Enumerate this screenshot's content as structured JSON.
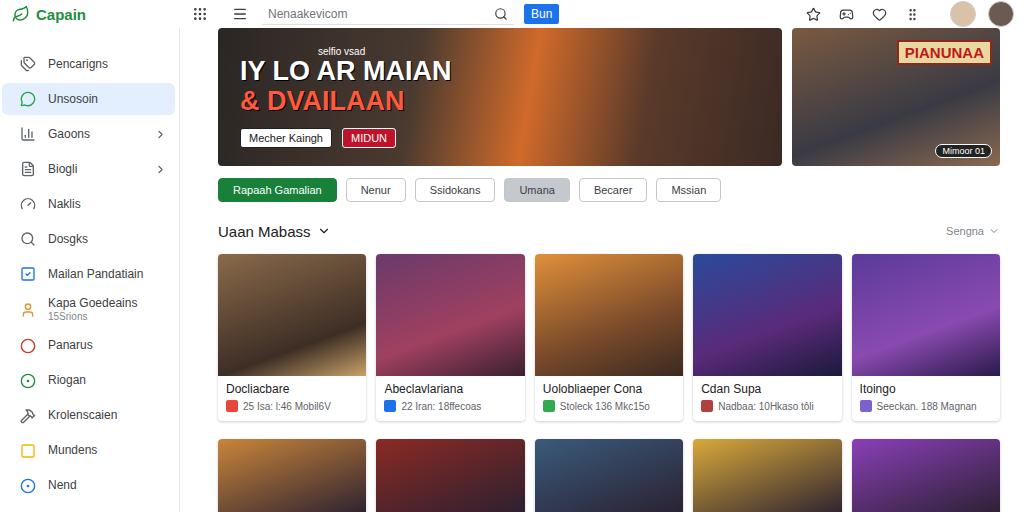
{
  "header": {
    "logo": "Capain",
    "search": {
      "placeholder": "Nenaakevicom"
    },
    "button": "Bun"
  },
  "sidebar": {
    "items": [
      {
        "label": "Pencarigns",
        "selected": false,
        "chevron": false,
        "color": "#5f6368"
      },
      {
        "label": "Unsosoin",
        "selected": true,
        "chevron": false,
        "color": "#25a244"
      },
      {
        "label": "Gaoons",
        "selected": false,
        "chevron": true,
        "color": "#5f6368"
      },
      {
        "label": "Biogli",
        "selected": false,
        "chevron": true,
        "color": "#5f6368"
      },
      {
        "label": "Naklis",
        "selected": false,
        "chevron": false,
        "color": "#5f6368"
      },
      {
        "label": "Dosgks",
        "selected": false,
        "chevron": false,
        "color": "#5f6368"
      },
      {
        "label": "Mailan Pandatiain",
        "selected": false,
        "chevron": false,
        "color": "#1a73e8"
      },
      {
        "label": "Kapa Goedeains",
        "sub": "15Srions",
        "selected": false,
        "chevron": false,
        "color": "#e8912d"
      },
      {
        "label": "Panarus",
        "selected": false,
        "chevron": false,
        "color": "#d93025"
      },
      {
        "label": "Riogan",
        "selected": false,
        "chevron": false,
        "color": "#1e8e3e"
      },
      {
        "label": "Krolenscaien",
        "selected": false,
        "chevron": false,
        "color": "#5f6368"
      },
      {
        "label": "Mundens",
        "selected": false,
        "chevron": false,
        "color": "#f4b400"
      },
      {
        "label": "Nend",
        "selected": false,
        "chevron": false,
        "color": "#1a73e8"
      }
    ]
  },
  "hero": {
    "kicker": "selfio vsad",
    "title": [
      "IY LO AR MAIAN",
      "& DVAILAAN"
    ],
    "buttons": [
      "Mecher Kaingh",
      "MIDUN"
    ]
  },
  "promo": {
    "title": "PIANUNAA",
    "badge": "Mimoor 01"
  },
  "filters": [
    {
      "label": "Rapaah Gamalian",
      "selected": true,
      "pressed": false
    },
    {
      "label": "Nenur",
      "selected": false,
      "pressed": false
    },
    {
      "label": "Ssidokans",
      "selected": false,
      "pressed": false
    },
    {
      "label": "Umana",
      "selected": false,
      "pressed": true
    },
    {
      "label": "Becarer",
      "selected": false,
      "pressed": false
    },
    {
      "label": "Mssian",
      "selected": false,
      "pressed": false
    }
  ],
  "section": {
    "title": "Uaan Mabass",
    "sort": "Sengna"
  },
  "cards": [
    {
      "title": "Docliacbare",
      "meta": "25 Isa: l:46 Mobil6V",
      "color": "#e8453c"
    },
    {
      "title": "Abeclavlariana",
      "meta": "22 Iran: 18ffecoas",
      "color": "#1a73e8"
    },
    {
      "title": "Uolobliaeper Cona",
      "meta": "Stoleck 136 Mkc15o",
      "color": "#34a853"
    },
    {
      "title": "Cdan Supa",
      "meta": "Nadbaa: 10Hkaso tôli",
      "color": "#b0413e"
    },
    {
      "title": "Itoingo",
      "meta": "Seeckan. 188 Magnan",
      "color": "#7b61c9"
    }
  ],
  "more_cards": [
    {
      "color": "#c9853a"
    },
    {
      "color": "#8a2a24"
    },
    {
      "color": "#3a5a7a"
    },
    {
      "color": "#d9a93a"
    },
    {
      "color": "#8a3fb8"
    }
  ]
}
